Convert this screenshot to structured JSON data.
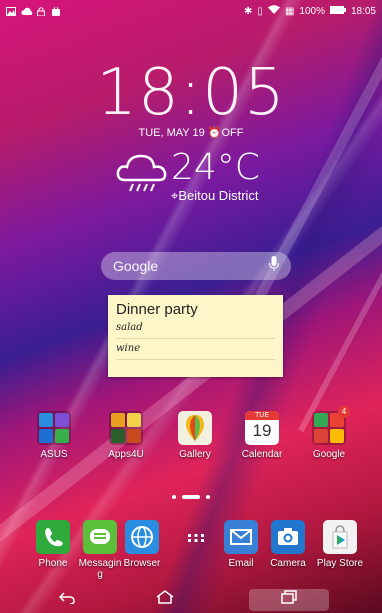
{
  "status_bar": {
    "battery": "100%",
    "time": "18:05"
  },
  "clock": {
    "time": "18:05",
    "date": "TUE, MAY 19",
    "alarm": "OFF"
  },
  "weather": {
    "temperature": "24°C",
    "location": "Beitou District",
    "icon": "cloud-rain-icon"
  },
  "search": {
    "label": "Google",
    "mic_icon": "mic-icon"
  },
  "note": {
    "title": "Dinner party",
    "lines": [
      "salad",
      "wine"
    ]
  },
  "apps_row": [
    {
      "label": "ASUS"
    },
    {
      "label": "Apps4U"
    },
    {
      "label": "Gallery"
    },
    {
      "label": "Calendar",
      "day": "TUE",
      "date": "19"
    },
    {
      "label": "Google",
      "badge": "4"
    }
  ],
  "dock": [
    {
      "label": "Phone"
    },
    {
      "label": "Messaging"
    },
    {
      "label": "Browser"
    },
    {
      "label": "All apps"
    },
    {
      "label": "Email"
    },
    {
      "label": "Camera"
    },
    {
      "label": "Play Store"
    }
  ],
  "colors": {
    "phone": "#2eaa3c",
    "messaging": "#5cbf3a",
    "browser": "#2a8de0",
    "email": "#3a7fd6",
    "camera": "#2277cc"
  }
}
